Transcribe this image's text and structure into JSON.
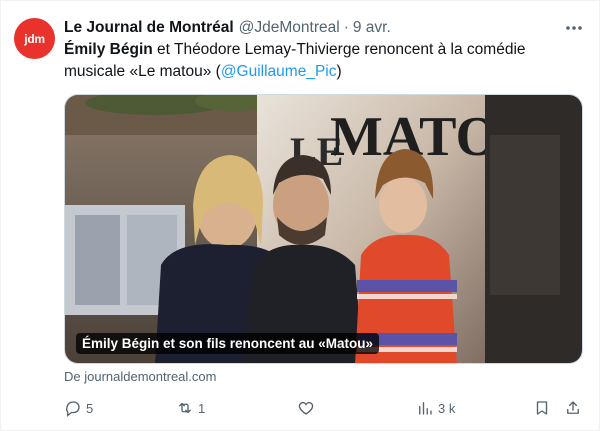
{
  "tweet": {
    "avatar_text": "jdm",
    "avatar_color": "#e8322b",
    "name": "Le Journal de Montréal",
    "handle": "@JdeMontreal",
    "separator": "·",
    "date": "9 avr.",
    "text_bold_1": "Émily Bégin",
    "text_part_1": " et Théodore Lemay-Thivierge renoncent à la comédie musicale «Le matou» (",
    "mention": "@Guillaume_Pic",
    "text_part_2": ")",
    "card": {
      "caption": "Émily Bégin et son fils renoncent au «Matou»",
      "poster_text": "MATOU",
      "poster_small": "LE"
    },
    "source": "De journaldemontreal.com",
    "actions": {
      "replies": "5",
      "retweets": "1",
      "likes": "",
      "views": "3 k"
    },
    "accent_color": "#1d9bf0",
    "muted_color": "#536471"
  }
}
